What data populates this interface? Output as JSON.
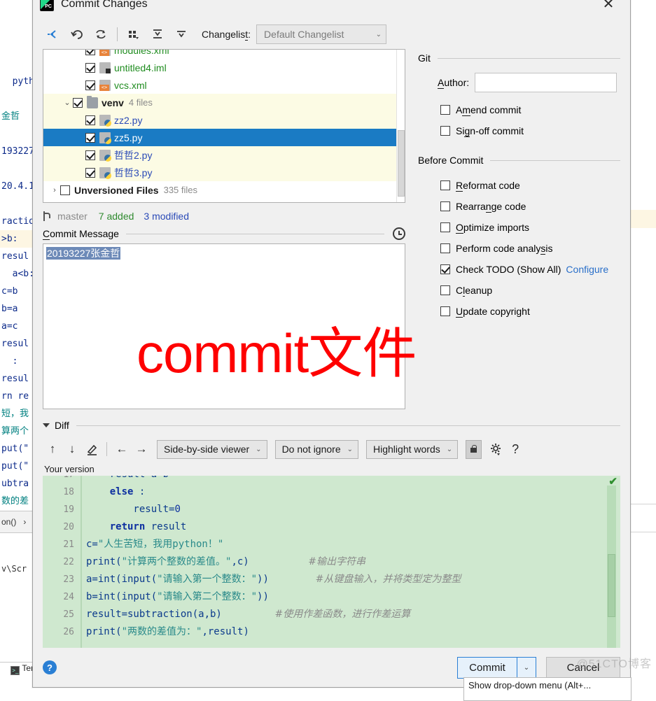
{
  "dialog": {
    "title": "Commit Changes",
    "close_label": "✕",
    "app_icon": "pycharm-icon"
  },
  "toolbar": {
    "icons": [
      {
        "name": "collapse-to-selection-icon",
        "glyph": "⇥"
      },
      {
        "name": "revert-icon",
        "glyph": "↺"
      },
      {
        "name": "refresh-icon",
        "glyph": "⟳"
      },
      {
        "name": "group-by-icon",
        "glyph": "▦"
      },
      {
        "name": "expand-all-icon",
        "glyph": "⤓"
      },
      {
        "name": "collapse-all-icon",
        "glyph": "⤒"
      }
    ],
    "changelist_label": "Changelist:",
    "changelist_value": "Default Changelist",
    "chevron": "⌄"
  },
  "tree": {
    "rows": [
      {
        "indent": 2,
        "checked": true,
        "icon": "xml",
        "name": "modules.xml",
        "color": "green",
        "count": "",
        "twisty": "",
        "state": "partial-top"
      },
      {
        "indent": 2,
        "checked": true,
        "icon": "iml",
        "name": "untitled4.iml",
        "color": "green",
        "count": "",
        "twisty": "",
        "state": "normal"
      },
      {
        "indent": 2,
        "checked": true,
        "icon": "xml",
        "name": "vcs.xml",
        "color": "green",
        "count": "",
        "twisty": "",
        "state": "normal"
      },
      {
        "indent": 1,
        "checked": true,
        "icon": "folder",
        "name": "venv",
        "color": "dark",
        "count": "4 files",
        "twisty": "⌄",
        "state": "shade"
      },
      {
        "indent": 2,
        "checked": true,
        "icon": "py",
        "name": "zz2.py",
        "color": "blue",
        "count": "",
        "twisty": "",
        "state": "shade"
      },
      {
        "indent": 2,
        "checked": true,
        "icon": "py",
        "name": "zz5.py",
        "color": "blue",
        "count": "",
        "twisty": "",
        "state": "selected"
      },
      {
        "indent": 2,
        "checked": true,
        "icon": "py",
        "name": "哲哲2.py",
        "color": "blue",
        "count": "",
        "twisty": "",
        "state": "shade"
      },
      {
        "indent": 2,
        "checked": true,
        "icon": "py",
        "name": "哲哲3.py",
        "color": "blue",
        "count": "",
        "twisty": "",
        "state": "shade"
      },
      {
        "indent": 0,
        "checked": false,
        "icon": "none",
        "name": "Unversioned Files",
        "color": "dark",
        "count": "335 files",
        "twisty": "›",
        "state": "normal"
      }
    ]
  },
  "status": {
    "branch": "master",
    "added": "7 added",
    "modified": "3 modified"
  },
  "commit_message": {
    "section_label": "Commit Message",
    "value": "20193227张金哲",
    "history_icon": "clock-icon"
  },
  "git_group": {
    "title": "Git",
    "author_label": "Author:",
    "author_value": "",
    "options": [
      {
        "label": "Amend commit",
        "checked": false
      },
      {
        "label": "Sign-off commit",
        "checked": false
      }
    ]
  },
  "before_commit_group": {
    "title": "Before Commit",
    "options": [
      {
        "label": "Reformat code",
        "checked": false,
        "link": ""
      },
      {
        "label": "Rearrange code",
        "checked": false,
        "link": ""
      },
      {
        "label": "Optimize imports",
        "checked": false,
        "link": ""
      },
      {
        "label": "Perform code analysis",
        "checked": false,
        "link": ""
      },
      {
        "label": "Check TODO (Show All)",
        "checked": true,
        "link": "Configure"
      },
      {
        "label": "Cleanup",
        "checked": false,
        "link": ""
      },
      {
        "label": "Update copyright",
        "checked": false,
        "link": ""
      }
    ]
  },
  "diff": {
    "section_label": "Diff",
    "nav_icons": [
      {
        "name": "previous-difference-icon",
        "glyph": "↑"
      },
      {
        "name": "next-difference-icon",
        "glyph": "↓"
      },
      {
        "name": "edit-source-icon",
        "glyph": "✎"
      },
      {
        "name": "accept-left-icon",
        "glyph": "←"
      },
      {
        "name": "accept-right-icon",
        "glyph": "→"
      }
    ],
    "viewer_mode": "Side-by-side viewer",
    "ignore_mode": "Do not ignore",
    "highlight_mode": "Highlight words",
    "lock_icon": "lock-icon",
    "settings_icon": "gear-icon",
    "help_icon": "question-mark-icon",
    "pane_label": "Your version",
    "chevron": "⌄",
    "ok_check": "✔"
  },
  "code": {
    "lines": [
      {
        "n": "17",
        "segments": [
          {
            "t": "    result=a-b",
            "c": "pl"
          }
        ],
        "comment": "",
        "clipped": true
      },
      {
        "n": "18",
        "segments": [
          {
            "t": "    ",
            "c": "pl"
          },
          {
            "t": "else",
            "c": "kw"
          },
          {
            "t": " :",
            "c": "pl"
          }
        ],
        "comment": ""
      },
      {
        "n": "19",
        "segments": [
          {
            "t": "        result=",
            "c": "pl"
          },
          {
            "t": "0",
            "c": "num"
          }
        ],
        "comment": ""
      },
      {
        "n": "20",
        "segments": [
          {
            "t": "    ",
            "c": "pl"
          },
          {
            "t": "return",
            "c": "kw"
          },
          {
            "t": " result",
            "c": "pl"
          }
        ],
        "comment": ""
      },
      {
        "n": "21",
        "segments": [
          {
            "t": "c=",
            "c": "pl"
          },
          {
            "t": "\"人生苦短，我用python！\"",
            "c": "str"
          }
        ],
        "comment": ""
      },
      {
        "n": "22",
        "segments": [
          {
            "t": "print(",
            "c": "pl"
          },
          {
            "t": "\"计算两个整数的差值。\"",
            "c": "str"
          },
          {
            "t": ",c)",
            "c": "pl"
          }
        ],
        "comment": "#输出字符串"
      },
      {
        "n": "23",
        "segments": [
          {
            "t": "a=int(input(",
            "c": "pl"
          },
          {
            "t": "\"请输入第一个整数：\"",
            "c": "str"
          },
          {
            "t": "))",
            "c": "pl"
          }
        ],
        "comment": "#从键盘输入，并将类型定为整型"
      },
      {
        "n": "24",
        "segments": [
          {
            "t": "b=int(input(",
            "c": "pl"
          },
          {
            "t": "\"请输入第二个整数：\"",
            "c": "str"
          },
          {
            "t": "))",
            "c": "pl"
          }
        ],
        "comment": ""
      },
      {
        "n": "25",
        "segments": [
          {
            "t": "result=subtraction(a,b)",
            "c": "pl"
          }
        ],
        "comment": "#使用作差函数，进行作差运算"
      },
      {
        "n": "26",
        "segments": [
          {
            "t": "print(",
            "c": "pl"
          },
          {
            "t": "\"两数的差值为：\"",
            "c": "str"
          },
          {
            "t": ",result)",
            "c": "pl"
          }
        ],
        "comment": ""
      }
    ]
  },
  "footer": {
    "help_label": "?",
    "commit_label": "Commit",
    "commit_arrow": "⌄",
    "cancel_label": "Cancel",
    "tooltip": "Show drop-down menu (Alt+..."
  },
  "annotation": {
    "text": "commit文件",
    "color": "#fe0000"
  },
  "watermark": {
    "text": "@51CTO博客"
  },
  "background": {
    "editor_lines": [
      "  pyth",
      "",
      "金哲",
      "",
      "193227",
      "",
      "20.4.1",
      "",
      "ractio",
      ">b:",
      "resul",
      "  a<b:",
      "c=b",
      "b=a",
      "a=c",
      "resul",
      "  :",
      "resul",
      "rn re",
      "短，我",
      "算两个",
      "put(\"",
      "put(\"",
      "ubtra",
      "数的差"
    ],
    "run_line": "on()   ›",
    "path_line": "v\\Scr",
    "terminal_label": "Ter"
  }
}
